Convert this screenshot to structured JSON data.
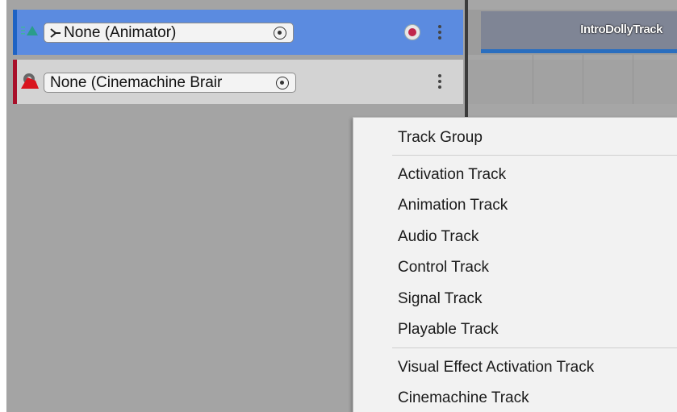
{
  "tracks": [
    {
      "binding": "None (Animator)",
      "color": "#1f63c4",
      "icon": "animation-track-icon",
      "has_record": true
    },
    {
      "binding": "None (Cinemachine Brair",
      "color": "#a8102a",
      "icon": "cinemachine-track-icon",
      "has_record": false
    }
  ],
  "timeline": {
    "clip_label": "IntroDollyTrack",
    "clip_color": "#7f8595",
    "clip_bar_color": "#2b6fbf"
  },
  "context_menu": {
    "group_item": "Track Group",
    "track_items": [
      "Activation Track",
      "Animation Track",
      "Audio Track",
      "Control Track",
      "Signal Track",
      "Playable Track"
    ],
    "extra_items": [
      "Visual Effect Activation Track",
      "Cinemachine Track"
    ]
  }
}
